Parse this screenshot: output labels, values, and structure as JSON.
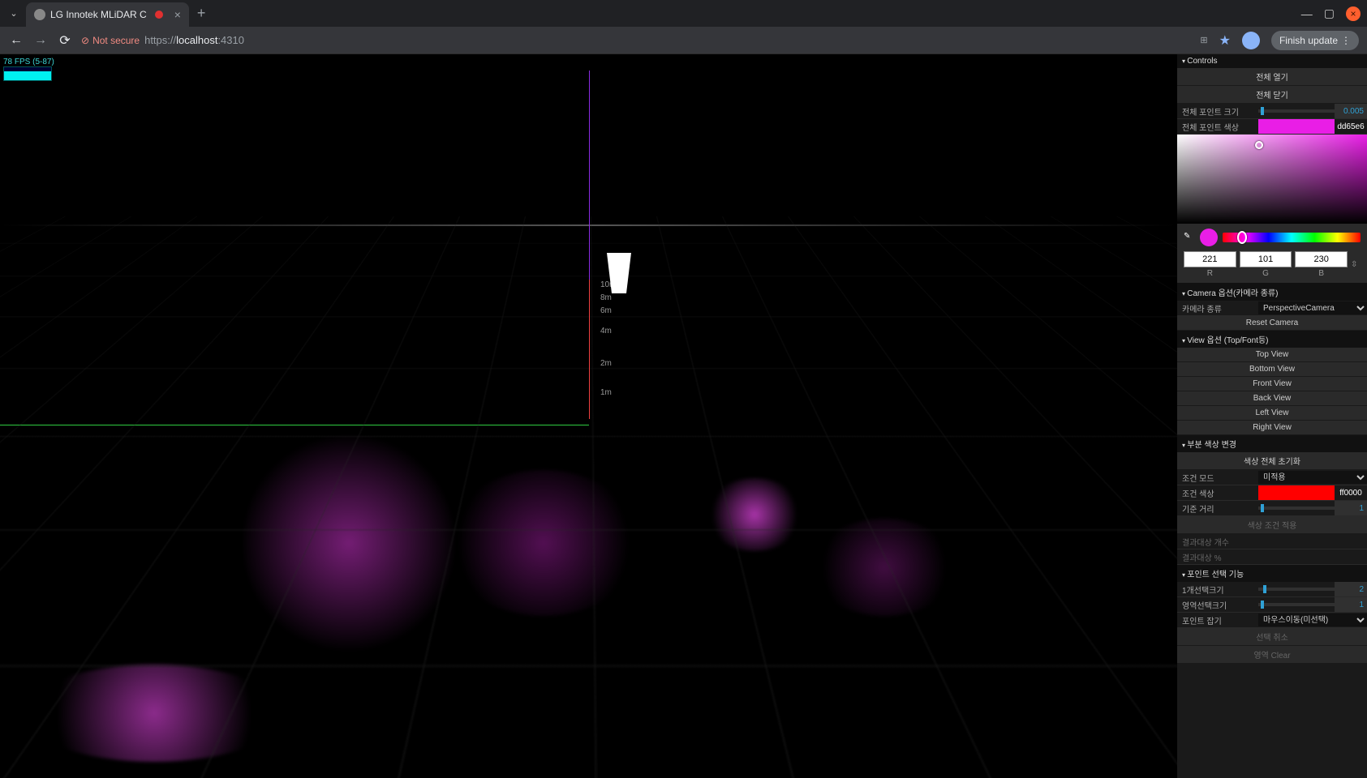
{
  "browser": {
    "tab_title": "LG Innotek MLiDAR C",
    "insecure_label": "Not secure",
    "url_proto": "https://",
    "url_host": "localhost",
    "url_port": ":4310",
    "finish_label": "Finish update"
  },
  "fps": {
    "text": "78 FPS (5-87)"
  },
  "scene": {
    "axis_labels": [
      "10m",
      "8m",
      "6m",
      "4m",
      "2m",
      "1m"
    ]
  },
  "controls": {
    "title": "Controls",
    "open_all": "전체 열기",
    "close_all": "전체 닫기",
    "point_size_label": "전체 포인트 크기",
    "point_size_value": "0.005",
    "point_color_label": "전체 포인트 색상",
    "point_color_hex": "dd65e6",
    "point_color_swatch": "#e91ee6",
    "hidden_num": "2"
  },
  "picker": {
    "r": "221",
    "g": "101",
    "b": "230",
    "r_lab": "R",
    "g_lab": "G",
    "b_lab": "B",
    "current": "#e91ee6"
  },
  "camera": {
    "title": "Camera 옵션(카메라 종류)",
    "type_label": "카메라 종류",
    "type_value": "PerspectiveCamera",
    "reset": "Reset Camera"
  },
  "view": {
    "title": "View 옵션 (Top/Font등)",
    "top": "Top View",
    "bottom": "Bottom View",
    "front": "Front View",
    "back": "Back View",
    "left": "Left View",
    "right": "Right View"
  },
  "partial": {
    "title": "부분 색상 변경",
    "reset": "색상 전체 초기화",
    "mode_label": "조건 모드",
    "mode_value": "미적용",
    "cond_color_label": "조건 색상",
    "cond_color_hex": "ff0000",
    "cond_color_swatch": "#ff0000",
    "dist_label": "기준 거리",
    "dist_value": "1",
    "apply": "색상 조건 적용",
    "target_count": "결과대상 개수",
    "target_pct": "결과대상 %"
  },
  "pointsel": {
    "title": "포인트 선택 기능",
    "sel1_label": "1개선택크기",
    "sel1_value": "2",
    "area_label": "영역선택크기",
    "area_value": "1",
    "grab_label": "포인트 잡기",
    "grab_value": "마우스이동(미선택)",
    "cancel": "선택 취소",
    "clear": "영역 Clear"
  }
}
